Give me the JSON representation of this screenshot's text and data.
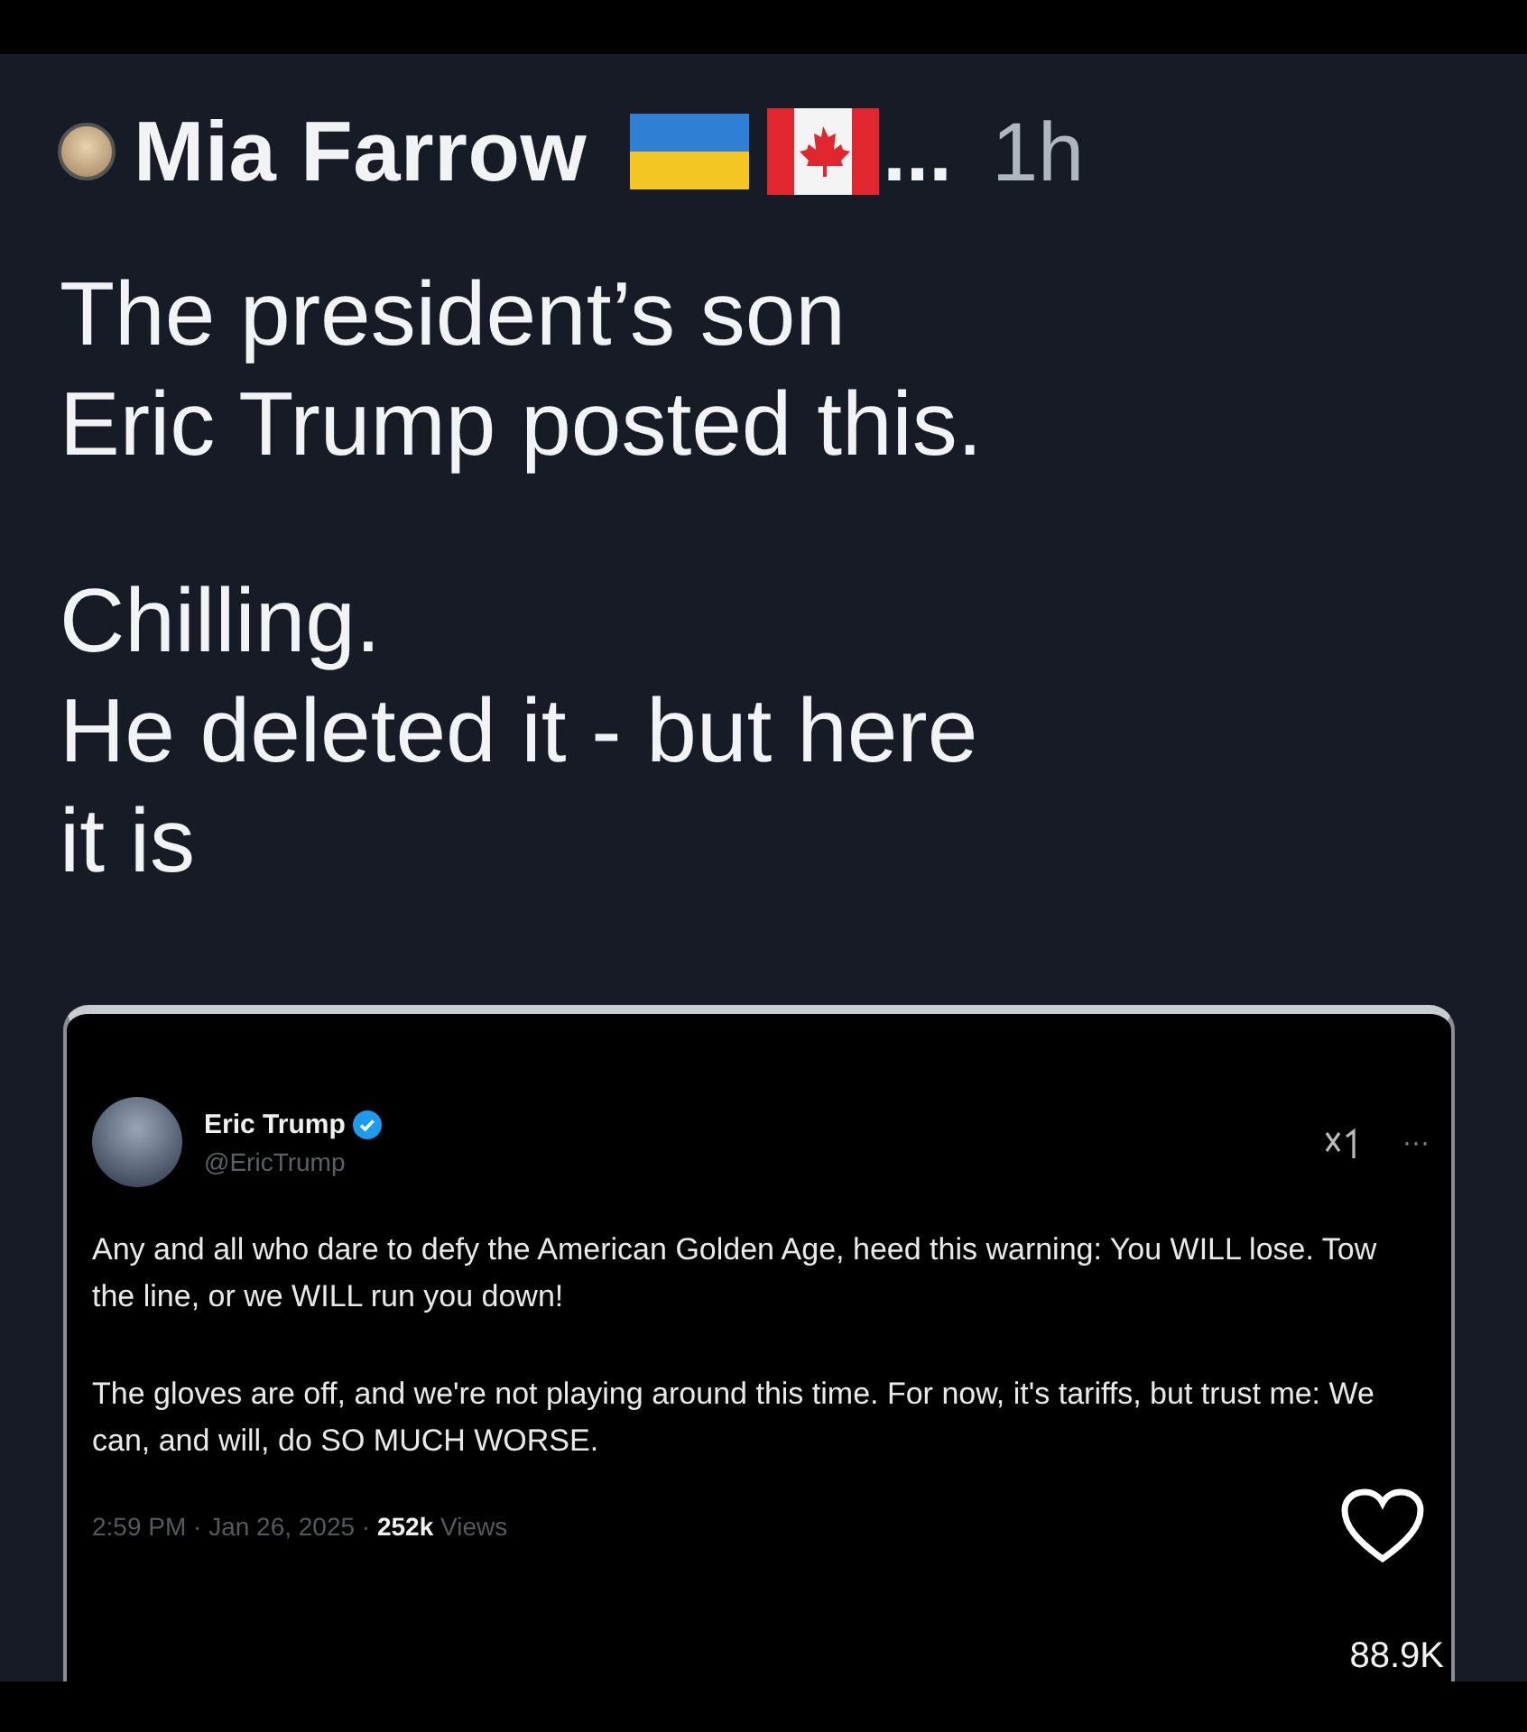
{
  "post": {
    "author": "Mia Farrow",
    "name_ellipsis": "...",
    "time": "1h",
    "lines": [
      "The president’s son",
      "Eric Trump posted this.",
      "Chilling.",
      "He deleted it - but here",
      "it is"
    ]
  },
  "embedded_tweet": {
    "name": "Eric Trump",
    "verified": true,
    "handle": "@EricTrump",
    "more": "···",
    "paragraphs": [
      "Any and all who dare to defy the American Golden Age, heed this warning: You WILL lose. Tow the line, or we WILL run you down!",
      "The gloves are off, and we're not playing around this time. For now, it's tariffs, but trust me: We can, and will, do SO MUCH WORSE."
    ],
    "meta": "2:59 PM · Jan 26, 2025 · **252k** Views",
    "like_count": "88.9K"
  }
}
